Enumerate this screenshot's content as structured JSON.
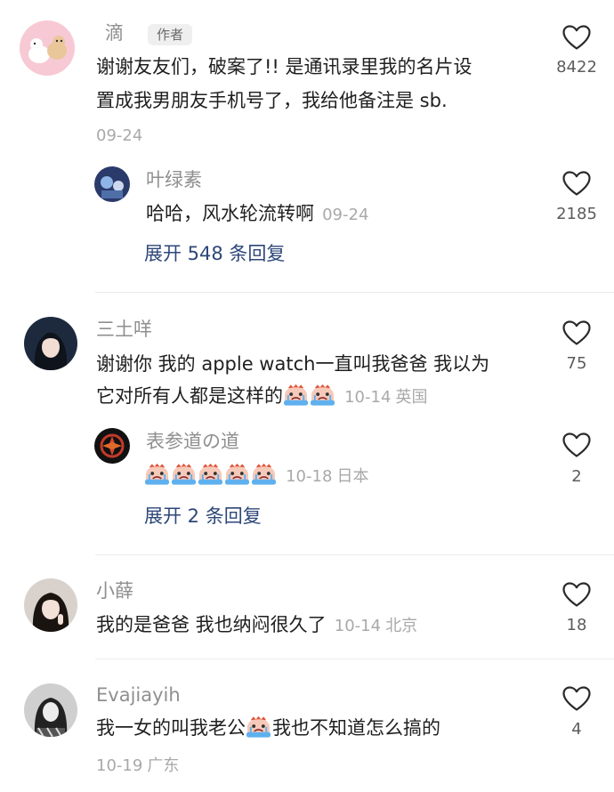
{
  "comments": [
    {
      "name": "滴",
      "tag": "作者",
      "text_line1": "谢谢友友们，破案了!! 是通讯录里我的名片设",
      "text_line2": "置成我男朋友手机号了，我给他备注是 sb.",
      "date": "09-24",
      "likes": "8422",
      "reply": {
        "name": "叶绿素",
        "text": "哈哈，风水轮流转啊",
        "date": "09-24",
        "likes": "2185"
      },
      "expand": "展开 548 条回复"
    },
    {
      "name": "三土咩",
      "text_line1": "谢谢你 我的 apple watch一直叫我爸爸 我以为",
      "text_line2": "它对所有人都是这样的",
      "date": "10-14",
      "location": "英国",
      "likes": "75",
      "reply": {
        "name": "表参道の道",
        "date": "10-18",
        "location": "日本",
        "likes": "2"
      },
      "expand": "展开 2 条回复"
    },
    {
      "name": "小薛",
      "text": "我的是爸爸 我也纳闷很久了",
      "date": "10-14",
      "location": "北京",
      "likes": "18"
    },
    {
      "name": "Evajiayih",
      "text_before": "我一女的叫我老公",
      "text_after": "我也不知道怎么搞的",
      "date": "10-19",
      "location": "广东",
      "likes": "4"
    }
  ],
  "icons": {
    "like": "heart-outline-icon",
    "emoji": "crying-face-emoji"
  }
}
